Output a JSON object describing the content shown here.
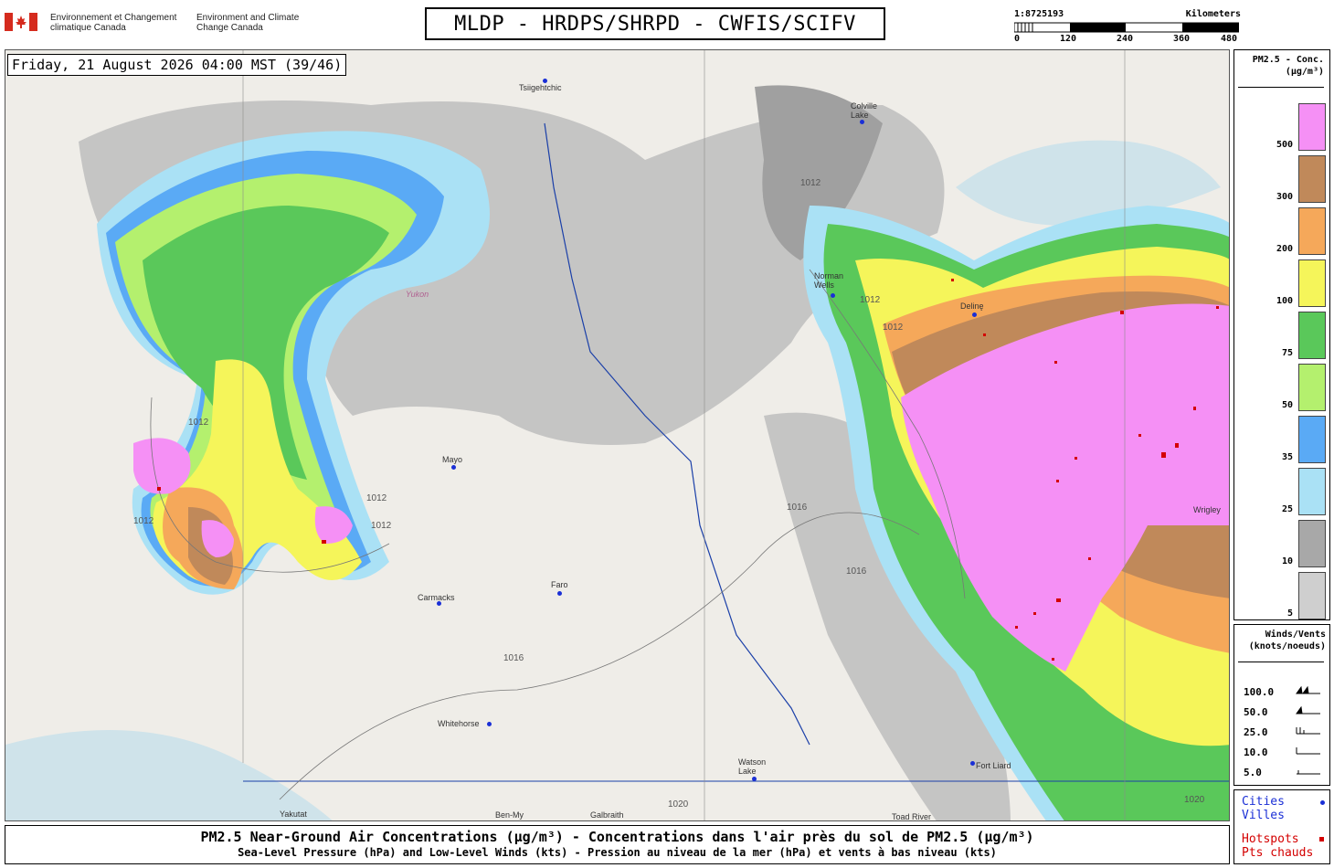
{
  "header": {
    "gov_fr": "Environnement et Changement climatique Canada",
    "gov_en": "Environment and Climate Change Canada",
    "title": "MLDP - HRDPS/SHRPD - CWFIS/SCIFV"
  },
  "scalebar": {
    "scale": "1:8725193",
    "unit": "Kilometers",
    "ticks": [
      "0",
      "120",
      "240",
      "360",
      "480"
    ]
  },
  "map": {
    "datetime": "Friday, 21 August 2026 04:00 MST (39/46)",
    "cities": [
      "Tsiigehtchic",
      "Colville Lake",
      "Norman Wells",
      "Delinę",
      "Mayo",
      "Faro",
      "Carmacks",
      "Whitehorse",
      "Watson Lake",
      "Yakutat",
      "Galbraith",
      "Ben-My",
      "Toad River",
      "Fort Liard",
      "Wrigley"
    ],
    "region_labels": [
      "Yukon"
    ],
    "isobars": [
      "1012",
      "1016",
      "1020"
    ],
    "colors": {
      "pink": "#f590f5",
      "brown": "#c0895a",
      "orange": "#f5a85a",
      "yellow": "#f5f55a",
      "green": "#5ac85a",
      "lightgreen": "#b4f06e",
      "blue": "#5aaaf5",
      "lightblue": "#aae1f5",
      "gray": "#a8a8a8",
      "lightgray": "#cfcfcf",
      "hotspot": "#d40000",
      "city": "#1a2fd6"
    }
  },
  "legend": {
    "title_line1": "PM2.5 - Conc.",
    "title_line2": "(µg/m³)",
    "bins": [
      {
        "label": "500",
        "color": "#f590f5"
      },
      {
        "label": "300",
        "color": "#c0895a"
      },
      {
        "label": "200",
        "color": "#f5a85a"
      },
      {
        "label": "100",
        "color": "#f5f55a"
      },
      {
        "label": "75",
        "color": "#5ac85a"
      },
      {
        "label": "50",
        "color": "#b4f06e"
      },
      {
        "label": "35",
        "color": "#5aaaf5"
      },
      {
        "label": "25",
        "color": "#aae1f5"
      },
      {
        "label": "10",
        "color": "#a8a8a8"
      },
      {
        "label": "5",
        "color": "#cfcfcf"
      }
    ]
  },
  "winds": {
    "title_line1": "Winds/Vents",
    "title_line2": "(knots/noeuds)",
    "rows": [
      "100.0",
      "50.0",
      "25.0",
      "10.0",
      "5.0"
    ]
  },
  "key": {
    "cities_en": "Cities",
    "cities_fr": "Villes",
    "hotspots_en": "Hotspots",
    "hotspots_fr": "Pts chauds"
  },
  "footer": {
    "line1": "PM2.5 Near-Ground Air Concentrations (µg/m³) - Concentrations dans l'air près du sol de PM2.5 (µg/m³)",
    "line2": "Sea-Level Pressure (hPa) and Low-Level Winds (kts) - Pression au niveau de la mer (hPa) et vents à bas niveau (kts)"
  }
}
